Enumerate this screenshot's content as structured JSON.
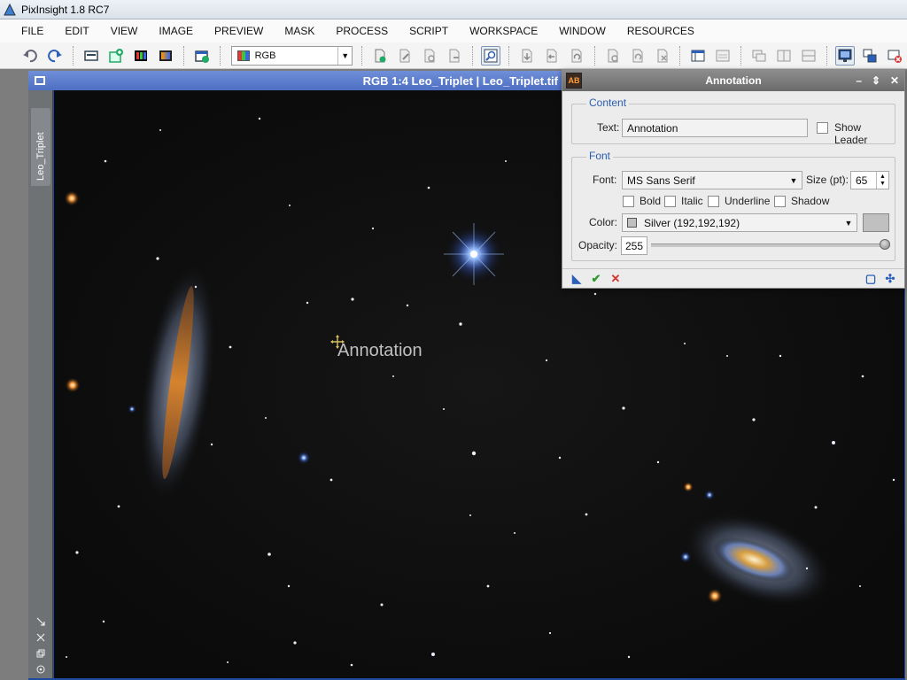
{
  "window": {
    "title": "PixInsight 1.8 RC7"
  },
  "menu": {
    "items": [
      "FILE",
      "EDIT",
      "VIEW",
      "IMAGE",
      "PREVIEW",
      "MASK",
      "PROCESS",
      "SCRIPT",
      "WORKSPACE",
      "WINDOW",
      "RESOURCES"
    ]
  },
  "toolbar": {
    "channel_value": "RGB"
  },
  "image_window": {
    "title": "RGB 1:4 Leo_Triplet | Leo_Triplet.tif",
    "side_tab": "Leo_Triplet",
    "annotation_text": "Annotation"
  },
  "dialog": {
    "title": "Annotation",
    "icon_text": "AB",
    "content_group": "Content",
    "text_label": "Text:",
    "text_value": "Annotation",
    "show_leader_label": "Show Leader",
    "font_group": "Font",
    "font_label": "Font:",
    "font_value": "MS Sans Serif",
    "size_label": "Size (pt):",
    "size_value": "65",
    "bold_label": "Bold",
    "italic_label": "Italic",
    "underline_label": "Underline",
    "shadow_label": "Shadow",
    "color_label": "Color:",
    "color_value": "Silver (192,192,192)",
    "color_hex": "#c0c0c0",
    "opacity_label": "Opacity:",
    "opacity_value": "255"
  },
  "colors": {
    "image_window_accent": "#1e4aa0",
    "legend_blue": "#2a5db0"
  }
}
